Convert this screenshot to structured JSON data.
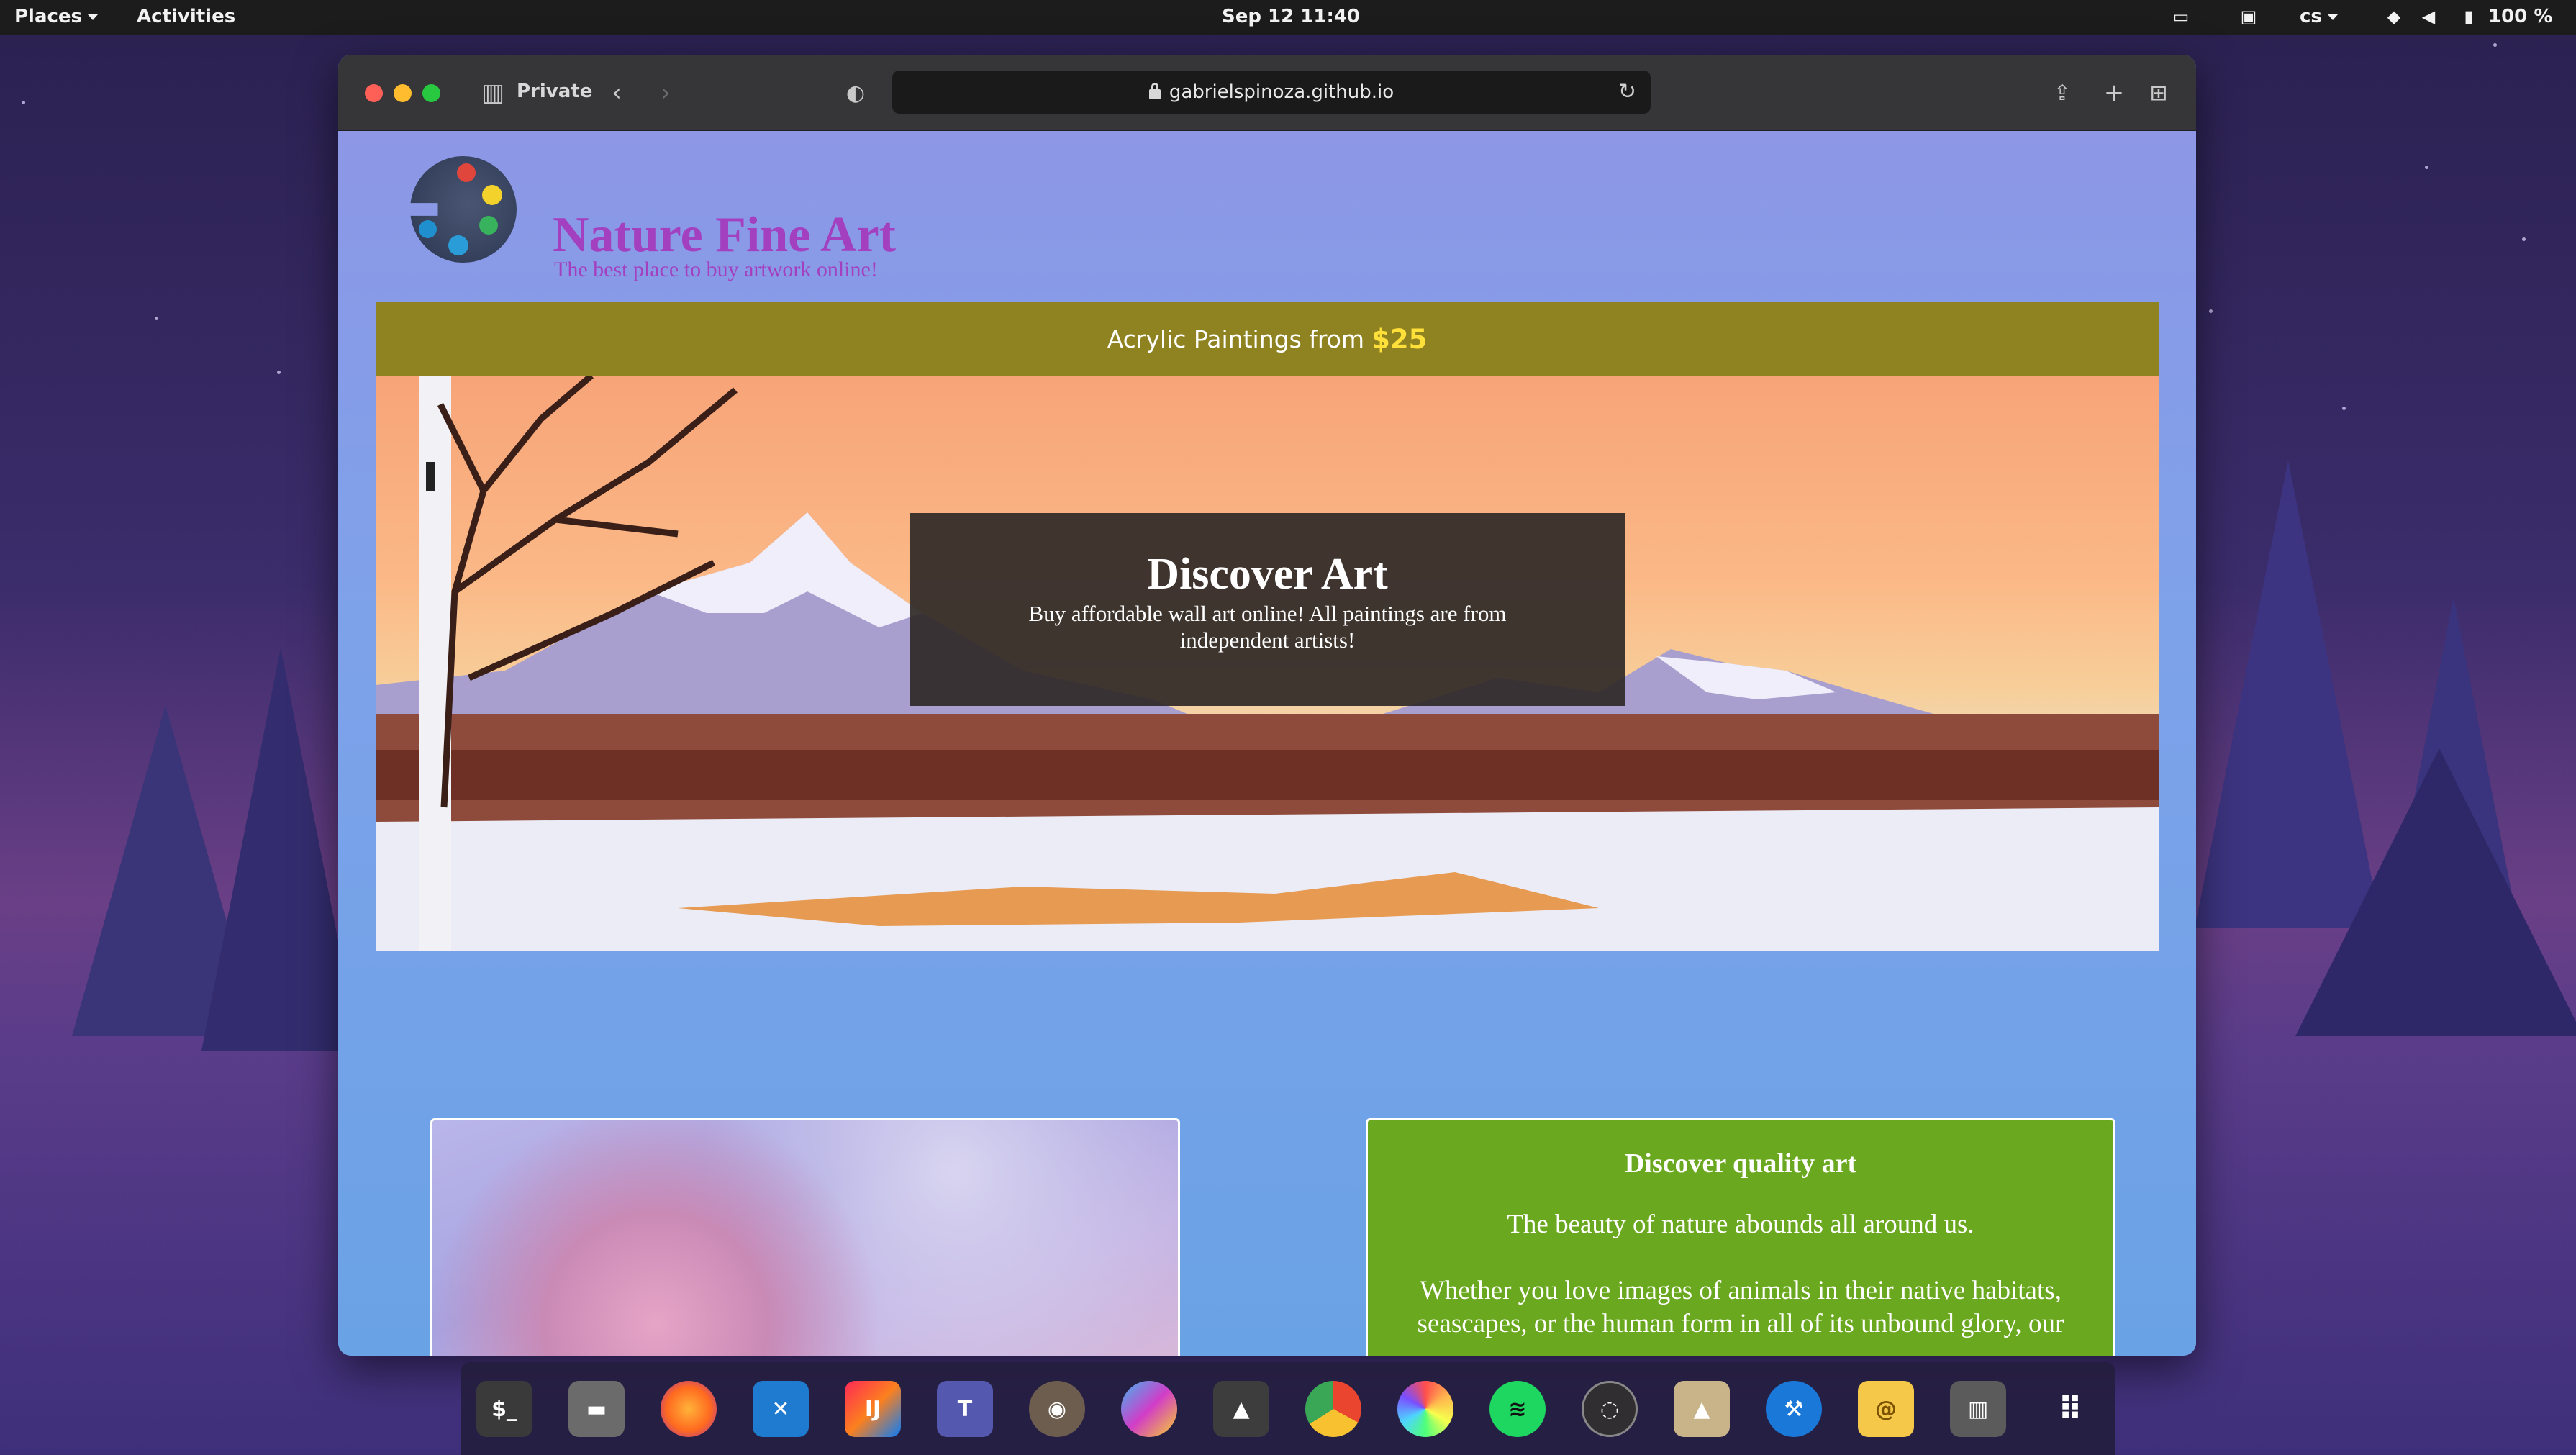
{
  "topbar": {
    "places_label": "Places",
    "activities_label": "Activities",
    "datetime": "Sep 12  11:40",
    "language": "cs",
    "battery": "100 %"
  },
  "browser": {
    "private_label": "Private",
    "url": "gabrielspinoza.github.io"
  },
  "site": {
    "title": "Nature Fine Art",
    "subtitle": "The best place to buy artwork online!",
    "promo_text": "Acrylic Paintings from",
    "promo_price": "$25",
    "hero_title": "Discover Art",
    "hero_text": "Buy affordable wall art online! All paintings are from independent artists!",
    "card_title": "Discover quality art",
    "card_p1": "The beauty of nature abounds all around us.",
    "card_p2": "Whether you love images of animals in their native habitats, seascapes, or the human form in all of its unbound glory, our"
  },
  "dock": {
    "apps": [
      "terminal-icon",
      "files-icon",
      "firefox-icon",
      "vscode-icon",
      "intellij-icon",
      "teams-icon",
      "gimp-icon",
      "krita-icon",
      "inkscape-icon",
      "chromium-icon",
      "aperture-icon",
      "spotify-icon",
      "obs-icon",
      "launcher-icon",
      "xcode-icon",
      "mail-icon",
      "trash-icon",
      "app-grid-icon"
    ]
  },
  "colors": {
    "title_purple": "#a340c0",
    "promo_olive": "#8f8220",
    "price_yellow": "#ffe03a",
    "card_green": "#6aa81f",
    "page_blue": "#6aa2e6"
  }
}
